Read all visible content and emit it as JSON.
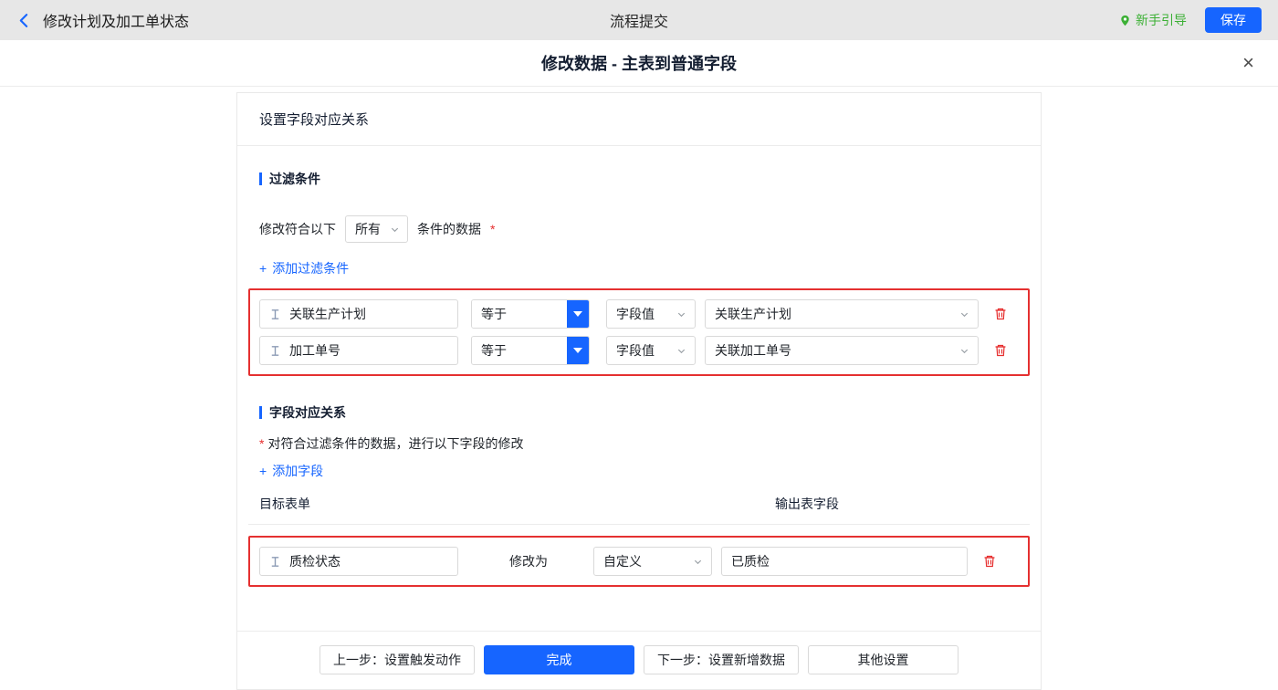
{
  "colors": {
    "primary": "#1665ff",
    "danger": "#e62e2e",
    "success": "#3cb035",
    "topbar-bg": "#e7e7e7",
    "border": "#d9d9d9"
  },
  "topbar": {
    "title": "修改计划及加工单状态",
    "center_title": "流程提交",
    "guide": "新手引导",
    "save": "保存"
  },
  "modal": {
    "title": "修改数据 - 主表到普通字段",
    "close_icon": "×"
  },
  "panel": {
    "header": "设置字段对应关系"
  },
  "filter": {
    "title": "过滤条件",
    "cond_prefix": "修改符合以下",
    "cond_select": "所有",
    "cond_suffix": "条件的数据",
    "required": "*",
    "add_plus": "+",
    "add_label": "添加过滤条件",
    "rows": [
      {
        "field": "关联生产计划",
        "op": "等于",
        "type": "字段值",
        "value": "关联生产计划"
      },
      {
        "field": "加工单号",
        "op": "等于",
        "type": "字段值",
        "value": "关联加工单号"
      }
    ]
  },
  "mapping": {
    "title": "字段对应关系",
    "required": "*",
    "desc": "对符合过滤条件的数据，进行以下字段的修改",
    "add_plus": "+",
    "add_label": "添加字段",
    "col_target": "目标表单",
    "col_output": "输出表字段",
    "rows": [
      {
        "field": "质检状态",
        "action": "修改为",
        "type": "自定义",
        "value": "已质检"
      }
    ]
  },
  "footer": {
    "prev": "上一步：设置触发动作",
    "done": "完成",
    "next": "下一步：设置新增数据",
    "other": "其他设置"
  }
}
